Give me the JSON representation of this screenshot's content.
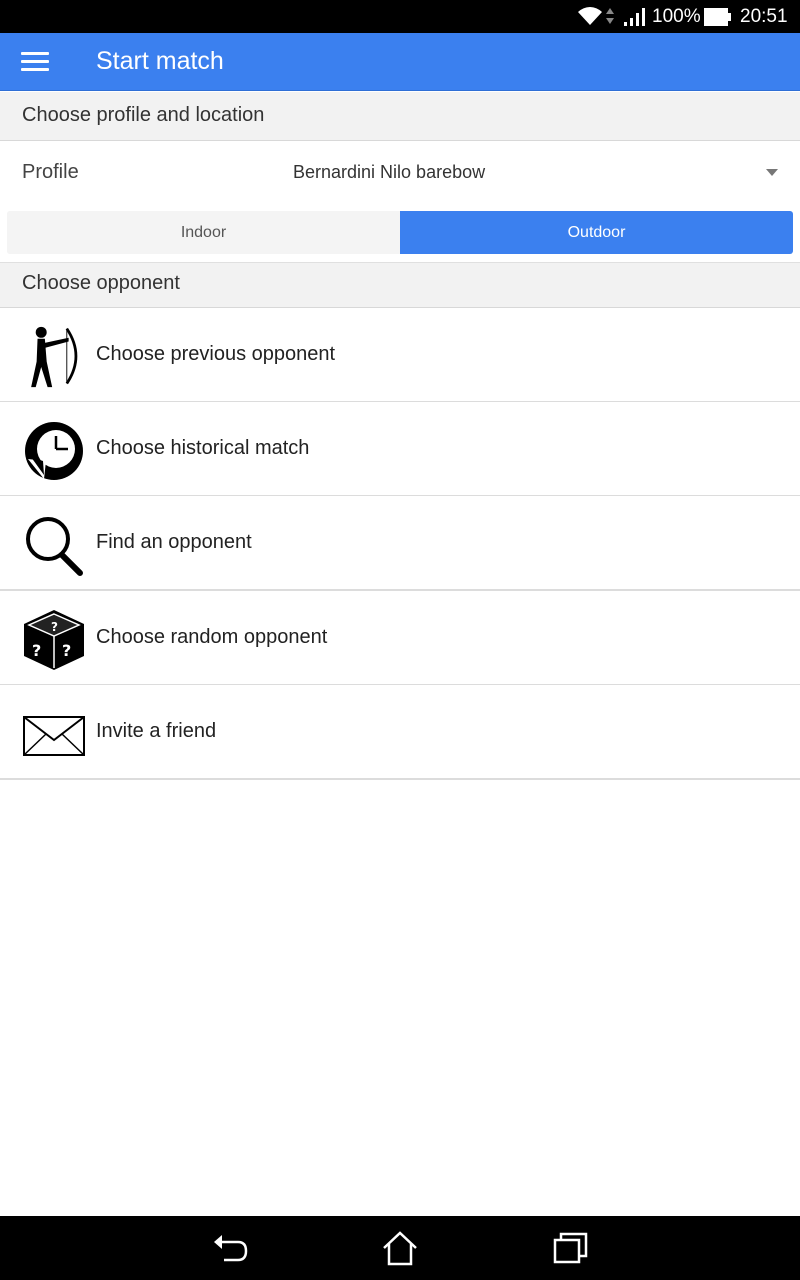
{
  "status_bar": {
    "battery_percent": "100%",
    "time": "20:51"
  },
  "app_bar": {
    "title": "Start match",
    "menu_icon": "hamburger-menu-icon"
  },
  "profile_section": {
    "header": "Choose profile and location",
    "profile_label": "Profile",
    "profile_value": "Bernardini Nilo barebow",
    "location_options": [
      "Indoor",
      "Outdoor"
    ],
    "selected_location": "Outdoor"
  },
  "opponent_section": {
    "header": "Choose opponent",
    "items": [
      {
        "label": "Choose previous opponent",
        "icon": "archer-icon"
      },
      {
        "label": "Choose historical match",
        "icon": "history-clock-icon"
      },
      {
        "label": "Find an opponent",
        "icon": "magnifier-icon"
      },
      {
        "label": "Choose random opponent",
        "icon": "dice-icon"
      },
      {
        "label": "Invite a friend",
        "icon": "envelope-icon"
      }
    ]
  },
  "colors": {
    "accent": "#3b80ef",
    "section_bg": "#f2f2f2",
    "status_bar": "#000000"
  }
}
